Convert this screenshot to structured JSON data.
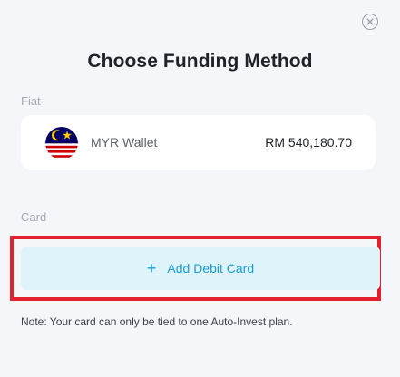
{
  "dialog": {
    "title": "Choose Funding Method",
    "close_icon": "close-circle-icon"
  },
  "fiat": {
    "section_label": "Fiat",
    "wallet": {
      "flag_icon": "malaysia-flag-icon",
      "name": "MYR Wallet",
      "balance": "RM 540,180.70"
    }
  },
  "card": {
    "section_label": "Card",
    "add_button": {
      "icon": "+",
      "label": "Add Debit Card"
    }
  },
  "note": "Note: Your card can only be tied to one Auto-Invest plan.",
  "colors": {
    "accent": "#1a9fd8",
    "button_bg": "#dff3fb",
    "highlight": "#e3202b",
    "background": "#f4f6f9"
  }
}
